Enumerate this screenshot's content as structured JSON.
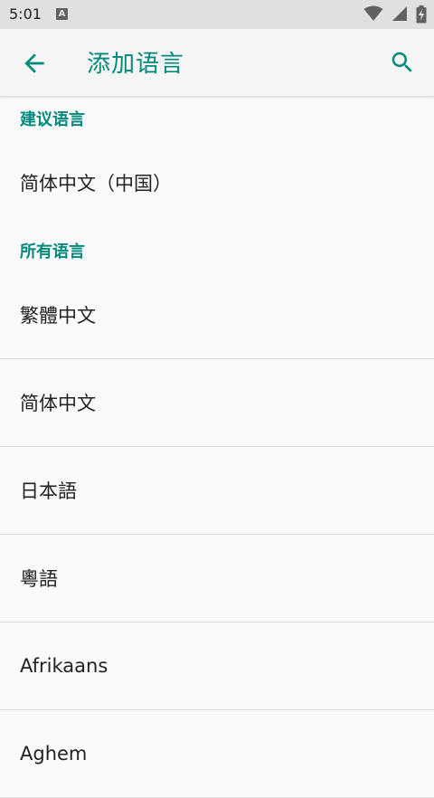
{
  "status_bar": {
    "time": "5:01",
    "a_label": "A",
    "icons": [
      "wifi-icon",
      "signal-icon",
      "battery-icon"
    ]
  },
  "app_bar": {
    "title": "添加语言",
    "back_icon": "arrow-left-icon",
    "search_icon": "search-icon",
    "accent_color": "#00897b"
  },
  "sections": {
    "suggested_header": "建议语言",
    "suggested_items": [
      "简体中文（中国）"
    ],
    "all_header": "所有语言",
    "all_items": [
      "繁體中文",
      "简体中文",
      "日本語",
      "粵語",
      "Afrikaans",
      "Aghem"
    ]
  }
}
